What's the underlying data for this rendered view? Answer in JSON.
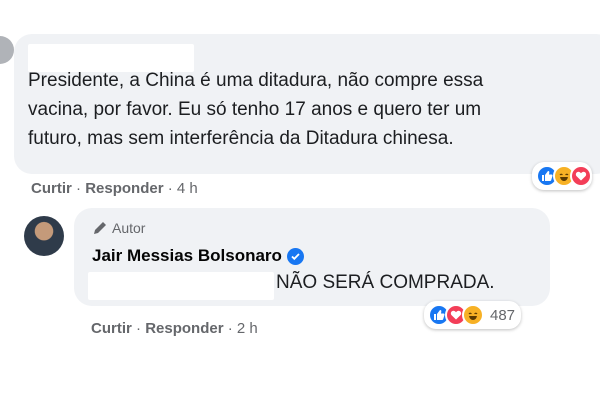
{
  "comment": {
    "lines": [
      "Presidente, a China é uma ditadura, não compre essa",
      "vacina, por favor. Eu só tenho 17 anos e quero ter um",
      "futuro, mas sem interferência da Ditadura chinesa."
    ],
    "like_label": "Curtir",
    "separator": "·",
    "reply_label": "Responder",
    "time": "4 h",
    "reactions": [
      "like",
      "haha",
      "love"
    ]
  },
  "reply": {
    "badge_label": "Autor",
    "author_name": "Jair Messias Bolsonaro",
    "text": "NÃO SERÁ COMPRADA.",
    "like_label": "Curtir",
    "separator": "·",
    "reply_label": "Responder",
    "time": "2 h",
    "reactions": [
      "like",
      "love",
      "haha"
    ],
    "reaction_count": "487"
  },
  "colors": {
    "bubble": "#f0f2f5",
    "secondary_text": "#65676b",
    "like_blue": "#1877f2",
    "love_red": "#f33e58",
    "haha_yellow": "#f7b125"
  }
}
